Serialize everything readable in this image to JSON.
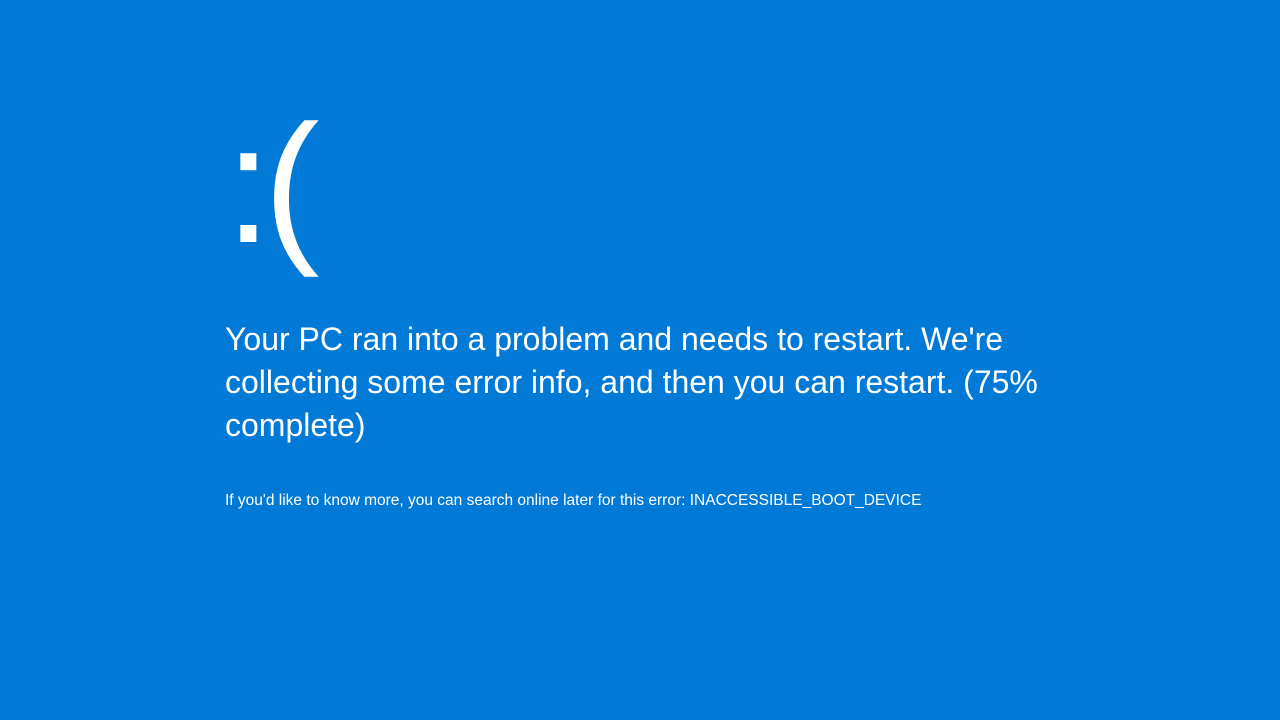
{
  "bsod": {
    "emoticon": ":(",
    "message": "Your PC ran into a problem and needs to restart. We're collecting some error info, and then you can restart. (75% complete)",
    "hint": "If you'd like to know more, you can search online later for this error: INACCESSIBLE_BOOT_DEVICE",
    "progress_percent": 75,
    "error_code": "INACCESSIBLE_BOOT_DEVICE",
    "background_color": "#0179d6"
  }
}
